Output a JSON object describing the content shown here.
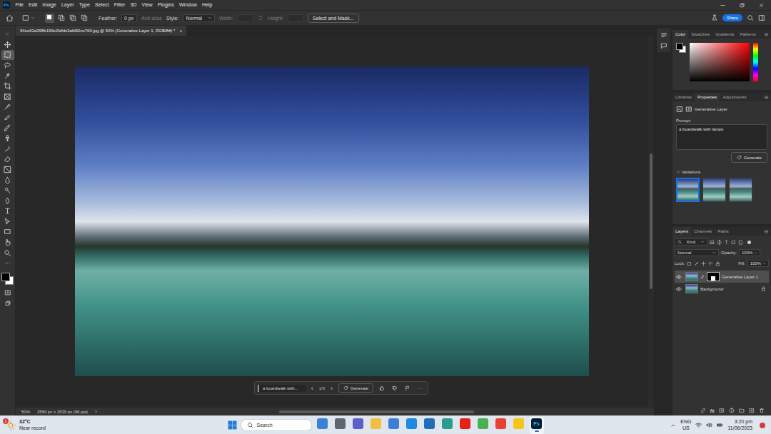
{
  "app": {
    "logo": "Ps"
  },
  "menu": [
    "File",
    "Edit",
    "Image",
    "Layer",
    "Type",
    "Select",
    "Filter",
    "3D",
    "View",
    "Plugins",
    "Window",
    "Help"
  ],
  "options_bar": {
    "selection_modes": [
      {
        "selected": true
      },
      {
        "selected": false
      },
      {
        "selected": false
      },
      {
        "selected": false
      }
    ],
    "feather_label": "Feather:",
    "feather_value": "0 px",
    "anti_alias": {
      "label": "Anti-alias",
      "disabled": true
    },
    "style_label": "Style:",
    "style_value": "Normal",
    "width": {
      "label": "Width:",
      "disabled": true
    },
    "height": {
      "label": "Height:",
      "disabled": true
    },
    "select_and_mask": "Select and Mask...",
    "share": "Share"
  },
  "document_tab": {
    "title": "94ee62a358b199c2fdfdc3afd02ce760.jpg @ 50% (Generative Layer 1, RGB/8#) *",
    "close": "×",
    "selected": true
  },
  "tools": [
    {
      "selected": false
    },
    {
      "selected": true
    },
    {
      "selected": false
    },
    {
      "selected": false
    },
    {
      "selected": false
    },
    {
      "selected": false
    },
    {
      "selected": false
    },
    {
      "selected": false
    },
    {
      "selected": false
    },
    {
      "selected": false
    },
    {
      "selected": false
    },
    {
      "selected": false
    },
    {
      "selected": false
    },
    {
      "selected": false
    },
    {
      "selected": false
    },
    {
      "selected": false
    },
    {
      "selected": false
    },
    {
      "selected": false
    },
    {
      "selected": false
    },
    {
      "selected": false
    },
    {
      "selected": false
    },
    {
      "selected": false
    }
  ],
  "contextual_task_bar": {
    "prompt": "a boardwalk with...",
    "prev": "‹",
    "counter": "1/3",
    "next": "›",
    "generate": "Generate",
    "more": "···"
  },
  "status_bar": {
    "zoom": "50%",
    "dimensions": "2560 px x 1539 px (96 ppi)",
    "arrow": "›"
  },
  "color_panel": {
    "tabs": [
      {
        "label": "Color",
        "selected": true
      },
      {
        "label": "Swatches",
        "selected": false
      },
      {
        "label": "Gradients",
        "selected": false
      },
      {
        "label": "Patterns",
        "selected": false
      }
    ]
  },
  "properties_panel": {
    "tabs": [
      {
        "label": "Libraries",
        "selected": false
      },
      {
        "label": "Properties",
        "selected": true
      },
      {
        "label": "Adjustments",
        "selected": false
      }
    ],
    "layer_type": "Generative Layer",
    "prompt_label": "Prompt:",
    "prompt": "a boardwalk with lamps",
    "generate": "Generate",
    "variations": {
      "label": "Variations",
      "expanded": true,
      "items": [
        {
          "selected": true
        },
        {
          "selected": false
        },
        {
          "selected": false
        }
      ]
    }
  },
  "layers_panel": {
    "tabs": [
      {
        "label": "Layers",
        "selected": true
      },
      {
        "label": "Channels",
        "selected": false
      },
      {
        "label": "Paths",
        "selected": false
      }
    ],
    "filter": "Kind",
    "blend_mode": "Normal",
    "opacity_label": "Opacity:",
    "opacity": "100%",
    "lock_label": "Lock:",
    "fill_label": "Fill:",
    "fill": "100%",
    "layers": [
      {
        "name": "Generative Layer 1",
        "visible": true,
        "selected": true,
        "locked": false,
        "kind": "generative"
      },
      {
        "name": "Background",
        "visible": true,
        "selected": false,
        "locked": true,
        "kind": "image"
      }
    ],
    "fx": "fx"
  },
  "taskbar": {
    "weather": {
      "temperature": "32°C",
      "note": "Near record",
      "badge": "1"
    },
    "search": "Search",
    "apps": [
      {
        "color": "#3b82d6",
        "active": false
      },
      {
        "color": "#5c6770",
        "active": false
      },
      {
        "color": "#5b5fc7",
        "active": false
      },
      {
        "color": "#f2c040",
        "active": false
      },
      {
        "color": "#3d7ed8",
        "active": false
      },
      {
        "color": "#1e88e5",
        "active": false
      },
      {
        "color": "#1f6fb8",
        "active": false
      },
      {
        "color": "#2a9d8f",
        "active": false
      },
      {
        "color": "#e62117",
        "active": false
      },
      {
        "color": "#4caf50",
        "active": false
      },
      {
        "color": "#e94235",
        "active": false
      },
      {
        "color": "#f5c518",
        "active": false
      },
      {
        "label": "Ps",
        "color": "#001e36",
        "active": true
      }
    ],
    "language": "ENG",
    "region": "US",
    "time": "3:20 pm",
    "date": "11/06/2023"
  }
}
